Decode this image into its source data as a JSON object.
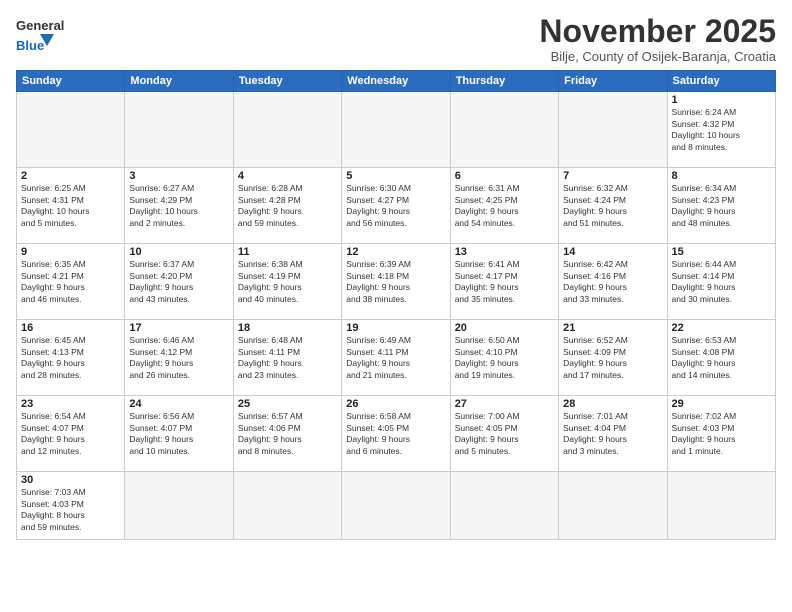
{
  "header": {
    "logo_general": "General",
    "logo_blue": "Blue",
    "month_title": "November 2025",
    "subtitle": "Bilje, County of Osijek-Baranja, Croatia"
  },
  "weekdays": [
    "Sunday",
    "Monday",
    "Tuesday",
    "Wednesday",
    "Thursday",
    "Friday",
    "Saturday"
  ],
  "weeks": [
    [
      {
        "day": "",
        "info": ""
      },
      {
        "day": "",
        "info": ""
      },
      {
        "day": "",
        "info": ""
      },
      {
        "day": "",
        "info": ""
      },
      {
        "day": "",
        "info": ""
      },
      {
        "day": "",
        "info": ""
      },
      {
        "day": "1",
        "info": "Sunrise: 6:24 AM\nSunset: 4:32 PM\nDaylight: 10 hours\nand 8 minutes."
      }
    ],
    [
      {
        "day": "2",
        "info": "Sunrise: 6:25 AM\nSunset: 4:31 PM\nDaylight: 10 hours\nand 5 minutes."
      },
      {
        "day": "3",
        "info": "Sunrise: 6:27 AM\nSunset: 4:29 PM\nDaylight: 10 hours\nand 2 minutes."
      },
      {
        "day": "4",
        "info": "Sunrise: 6:28 AM\nSunset: 4:28 PM\nDaylight: 9 hours\nand 59 minutes."
      },
      {
        "day": "5",
        "info": "Sunrise: 6:30 AM\nSunset: 4:27 PM\nDaylight: 9 hours\nand 56 minutes."
      },
      {
        "day": "6",
        "info": "Sunrise: 6:31 AM\nSunset: 4:25 PM\nDaylight: 9 hours\nand 54 minutes."
      },
      {
        "day": "7",
        "info": "Sunrise: 6:32 AM\nSunset: 4:24 PM\nDaylight: 9 hours\nand 51 minutes."
      },
      {
        "day": "8",
        "info": "Sunrise: 6:34 AM\nSunset: 4:23 PM\nDaylight: 9 hours\nand 48 minutes."
      }
    ],
    [
      {
        "day": "9",
        "info": "Sunrise: 6:35 AM\nSunset: 4:21 PM\nDaylight: 9 hours\nand 46 minutes."
      },
      {
        "day": "10",
        "info": "Sunrise: 6:37 AM\nSunset: 4:20 PM\nDaylight: 9 hours\nand 43 minutes."
      },
      {
        "day": "11",
        "info": "Sunrise: 6:38 AM\nSunset: 4:19 PM\nDaylight: 9 hours\nand 40 minutes."
      },
      {
        "day": "12",
        "info": "Sunrise: 6:39 AM\nSunset: 4:18 PM\nDaylight: 9 hours\nand 38 minutes."
      },
      {
        "day": "13",
        "info": "Sunrise: 6:41 AM\nSunset: 4:17 PM\nDaylight: 9 hours\nand 35 minutes."
      },
      {
        "day": "14",
        "info": "Sunrise: 6:42 AM\nSunset: 4:16 PM\nDaylight: 9 hours\nand 33 minutes."
      },
      {
        "day": "15",
        "info": "Sunrise: 6:44 AM\nSunset: 4:14 PM\nDaylight: 9 hours\nand 30 minutes."
      }
    ],
    [
      {
        "day": "16",
        "info": "Sunrise: 6:45 AM\nSunset: 4:13 PM\nDaylight: 9 hours\nand 28 minutes."
      },
      {
        "day": "17",
        "info": "Sunrise: 6:46 AM\nSunset: 4:12 PM\nDaylight: 9 hours\nand 26 minutes."
      },
      {
        "day": "18",
        "info": "Sunrise: 6:48 AM\nSunset: 4:11 PM\nDaylight: 9 hours\nand 23 minutes."
      },
      {
        "day": "19",
        "info": "Sunrise: 6:49 AM\nSunset: 4:11 PM\nDaylight: 9 hours\nand 21 minutes."
      },
      {
        "day": "20",
        "info": "Sunrise: 6:50 AM\nSunset: 4:10 PM\nDaylight: 9 hours\nand 19 minutes."
      },
      {
        "day": "21",
        "info": "Sunrise: 6:52 AM\nSunset: 4:09 PM\nDaylight: 9 hours\nand 17 minutes."
      },
      {
        "day": "22",
        "info": "Sunrise: 6:53 AM\nSunset: 4:08 PM\nDaylight: 9 hours\nand 14 minutes."
      }
    ],
    [
      {
        "day": "23",
        "info": "Sunrise: 6:54 AM\nSunset: 4:07 PM\nDaylight: 9 hours\nand 12 minutes."
      },
      {
        "day": "24",
        "info": "Sunrise: 6:56 AM\nSunset: 4:07 PM\nDaylight: 9 hours\nand 10 minutes."
      },
      {
        "day": "25",
        "info": "Sunrise: 6:57 AM\nSunset: 4:06 PM\nDaylight: 9 hours\nand 8 minutes."
      },
      {
        "day": "26",
        "info": "Sunrise: 6:58 AM\nSunset: 4:05 PM\nDaylight: 9 hours\nand 6 minutes."
      },
      {
        "day": "27",
        "info": "Sunrise: 7:00 AM\nSunset: 4:05 PM\nDaylight: 9 hours\nand 5 minutes."
      },
      {
        "day": "28",
        "info": "Sunrise: 7:01 AM\nSunset: 4:04 PM\nDaylight: 9 hours\nand 3 minutes."
      },
      {
        "day": "29",
        "info": "Sunrise: 7:02 AM\nSunset: 4:03 PM\nDaylight: 9 hours\nand 1 minute."
      }
    ],
    [
      {
        "day": "30",
        "info": "Sunrise: 7:03 AM\nSunset: 4:03 PM\nDaylight: 8 hours\nand 59 minutes."
      },
      {
        "day": "",
        "info": ""
      },
      {
        "day": "",
        "info": ""
      },
      {
        "day": "",
        "info": ""
      },
      {
        "day": "",
        "info": ""
      },
      {
        "day": "",
        "info": ""
      },
      {
        "day": "",
        "info": ""
      }
    ]
  ]
}
